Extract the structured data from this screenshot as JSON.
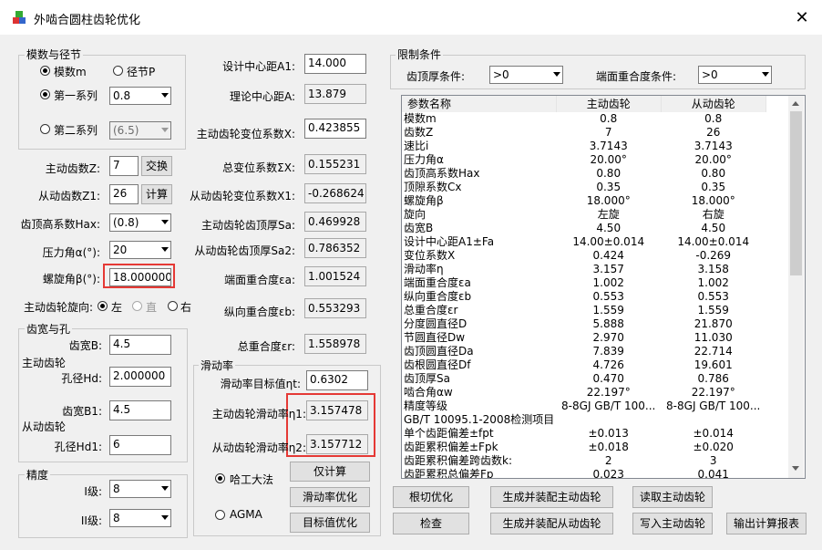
{
  "window": {
    "title": "外啮合圆柱齿轮优化",
    "close": "✕"
  },
  "module_pitch": {
    "legend": "模数与径节",
    "radio_module": "模数m",
    "radio_pitch": "径节P",
    "radio_series1": "第一系列",
    "series1_value": "0.8",
    "radio_series2": "第二系列",
    "series2_value": "(6.5)"
  },
  "left": {
    "z_label": "主动齿数Z:",
    "z_value": "7",
    "swap_btn": "交换",
    "z1_label": "从动齿数Z1:",
    "z1_value": "26",
    "calc_btn": "计算",
    "hax_label": "齿顶高系数Hax:",
    "hax_value": "(0.8)",
    "alpha_label": "压力角α(°):",
    "alpha_value": "20",
    "beta_label": "螺旋角β(°):",
    "beta_value": "18.000000",
    "hand_label": "主动齿轮旋向:",
    "hand_left": "左",
    "hand_straight": "直",
    "hand_right": "右"
  },
  "width_hole": {
    "legend": "齿宽与孔",
    "drive_label": "主动齿轮",
    "b_label": "齿宽B:",
    "b_value": "4.5",
    "hd_label": "孔径Hd:",
    "hd_value": "2.000000",
    "driven_label": "从动齿轮",
    "b1_label": "齿宽B1:",
    "b1_value": "4.5",
    "hd1_label": "孔径Hd1:",
    "hd1_value": "6"
  },
  "accuracy": {
    "legend": "精度",
    "grade1_label": "I级:",
    "grade1_value": "8",
    "grade2_label": "II级:",
    "grade2_value": "8"
  },
  "middle": {
    "a1_label": "设计中心距A1:",
    "a1_value": "14.000",
    "a_label": "理论中心距A:",
    "a_value": "13.879",
    "x_label": "主动齿轮变位系数X:",
    "x_value": "0.423855",
    "sx_label": "总变位系数ΣX:",
    "sx_value": "0.155231",
    "x1_label": "从动齿轮变位系数X1:",
    "x1_value": "-0.268624",
    "sa_label": "主动齿轮齿顶厚Sa:",
    "sa_value": "0.469928",
    "sa2_label": "从动齿轮齿顶厚Sa2:",
    "sa2_value": "0.786352",
    "ea_label": "端面重合度εa:",
    "ea_value": "1.001524",
    "eb_label": "纵向重合度εb:",
    "eb_value": "0.553293",
    "er_label": "总重合度εr:",
    "er_value": "1.558978"
  },
  "sliding": {
    "legend": "滑动率",
    "target_label": "滑动率目标值ηt:",
    "target_value": "0.6302",
    "n1_label": "主动齿轮滑动率η1:",
    "n1_value": "3.157478",
    "n2_label": "从动齿轮滑动率η2:",
    "n2_value": "3.157712",
    "radio_hit": "哈工大法",
    "radio_agma": "AGMA",
    "btn_calc_only": "仅计算",
    "btn_opt": "滑动率优化",
    "btn_target": "目标值优化"
  },
  "limits": {
    "legend": "限制条件",
    "tip_label": "齿顶厚条件:",
    "tip_value": ">0",
    "contact_label": "端面重合度条件:",
    "contact_value": ">0"
  },
  "table": {
    "headers": [
      "参数名称",
      "主动齿轮",
      "从动齿轮"
    ],
    "rows": [
      [
        "模数m",
        "0.8",
        "0.8"
      ],
      [
        "齿数Z",
        "7",
        "26"
      ],
      [
        "速比i",
        "3.7143",
        "3.7143"
      ],
      [
        "压力角α",
        "20.00°",
        "20.00°"
      ],
      [
        "齿顶高系数Hax",
        "0.80",
        "0.80"
      ],
      [
        "顶隙系数Cx",
        "0.35",
        "0.35"
      ],
      [
        "螺旋角β",
        "18.000°",
        "18.000°"
      ],
      [
        "旋向",
        "左旋",
        "右旋"
      ],
      [
        "齿宽B",
        "4.50",
        "4.50"
      ],
      [
        "设计中心距A1±Fa",
        "14.00±0.014",
        "14.00±0.014"
      ],
      [
        "变位系数X",
        "0.424",
        "-0.269"
      ],
      [
        "滑动率η",
        "3.157",
        "3.158"
      ],
      [
        "端面重合度εa",
        "1.002",
        "1.002"
      ],
      [
        "纵向重合度εb",
        "0.553",
        "0.553"
      ],
      [
        "总重合度εr",
        "1.559",
        "1.559"
      ],
      [
        "分度圆直径D",
        "5.888",
        "21.870"
      ],
      [
        "节圆直径Dw",
        "2.970",
        "11.030"
      ],
      [
        "齿顶圆直径Da",
        "7.839",
        "22.714"
      ],
      [
        "齿根圆直径Df",
        "4.726",
        "19.601"
      ],
      [
        "齿顶厚Sa",
        "0.470",
        "0.786"
      ],
      [
        "啮合角αw",
        "22.197°",
        "22.197°"
      ],
      [
        "精度等级",
        "8-8GJ GB/T 100...",
        "8-8GJ GB/T 100..."
      ],
      [
        "GB/T 10095.1-2008检测项目",
        "",
        ""
      ],
      [
        "单个齿距偏差±fpt",
        "±0.013",
        "±0.014"
      ],
      [
        "齿距累积偏差±Fpk",
        "±0.018",
        "±0.020"
      ],
      [
        "齿距累积偏差跨齿数k:",
        "2",
        "3"
      ],
      [
        "齿距累积总偏差Fp",
        "0.023",
        "0.041"
      ]
    ]
  },
  "buttons": {
    "root_opt": "根切优化",
    "check": "检查",
    "gen_drive": "生成并装配主动齿轮",
    "gen_driven": "生成并装配从动齿轮",
    "read_drive": "读取主动齿轮",
    "write_drive": "写入主动齿轮",
    "export": "输出计算报表"
  }
}
